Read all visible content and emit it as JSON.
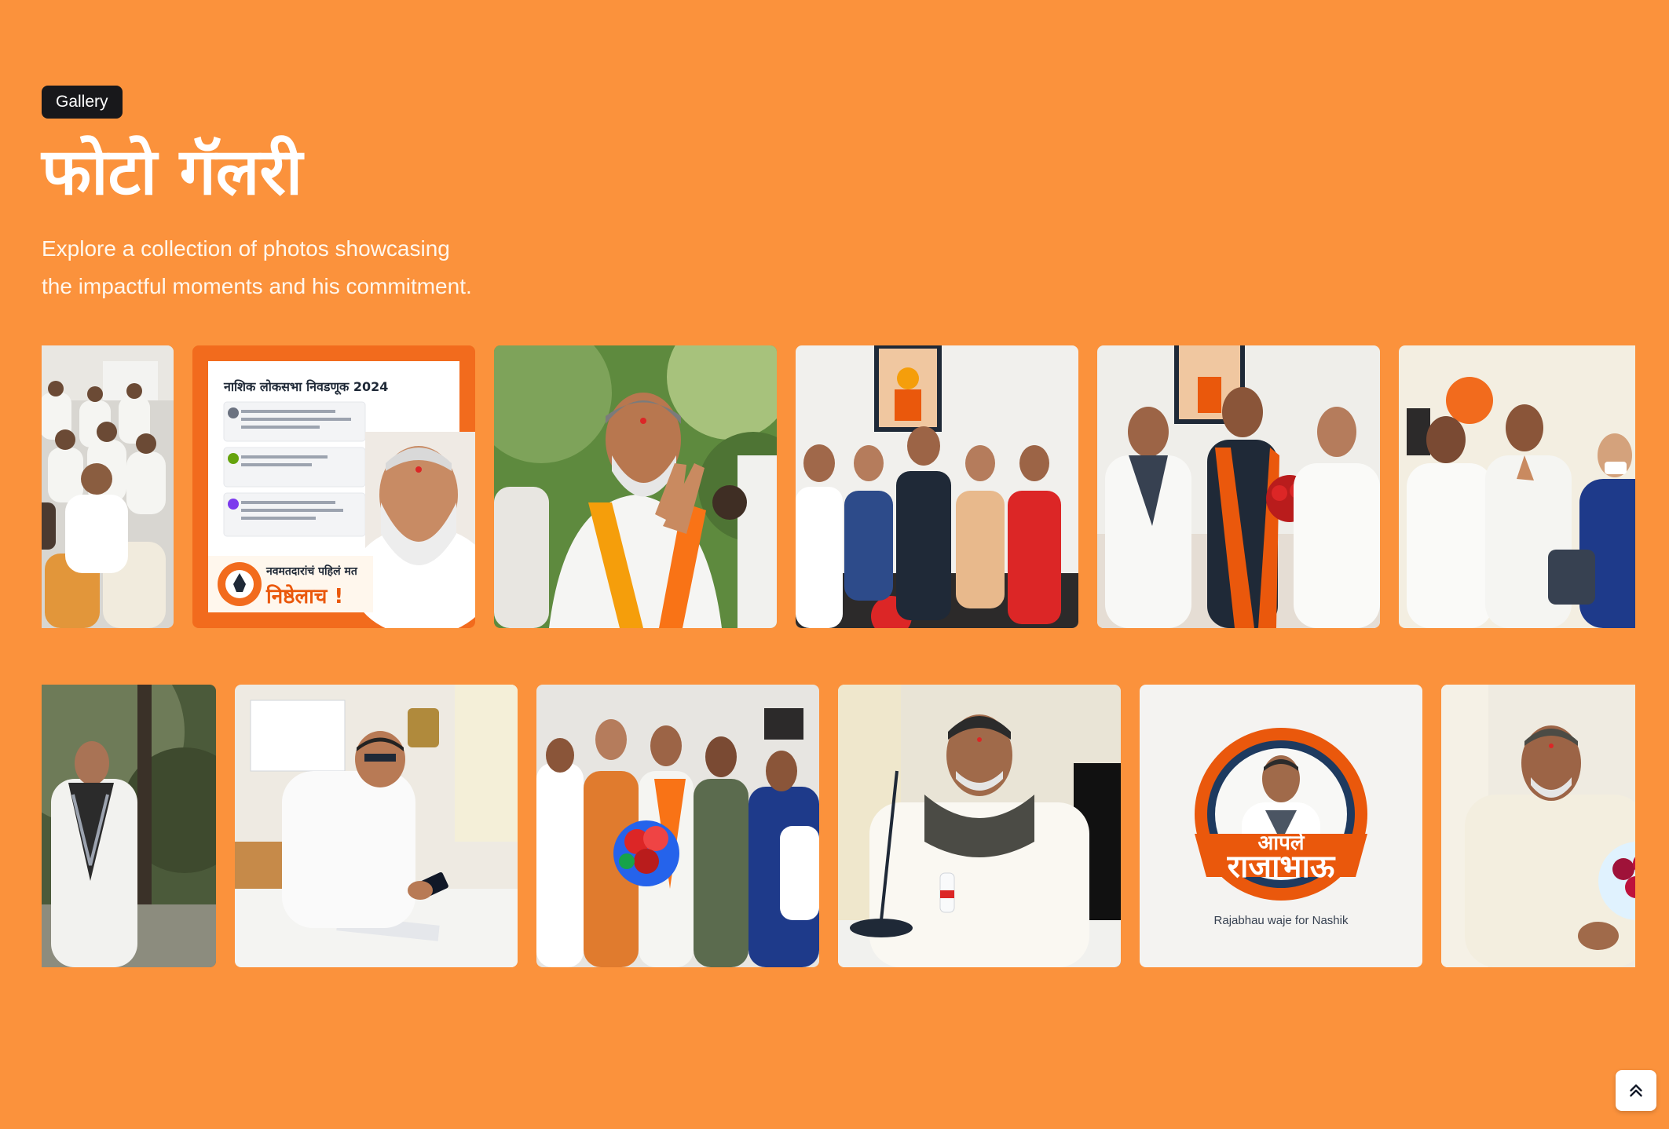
{
  "section": {
    "badge": "Gallery",
    "title": "फोटो गॅलरी",
    "subtitle_line1": "Explore a collection of photos showcasing",
    "subtitle_line2": "the impactful moments and his commitment."
  },
  "colors": {
    "page_background": "#FB923C",
    "badge_background": "#18181B",
    "title_text": "#FFFFFF",
    "accent_orange": "#F97316"
  },
  "gallery": {
    "row1": [
      {
        "alt": "group of supporters seated in an office meeting"
      },
      {
        "alt": "campaign poster",
        "heading": "नाशिक लोकसभा निवडणूक 2024",
        "slogan_top": "नवमतदारांचं पहिलं मत",
        "slogan_bottom": "निष्ठेलाच !"
      },
      {
        "alt": "greeting with folded hands wearing saffron scarf"
      },
      {
        "alt": "group photo in front of a framed portrait"
      },
      {
        "alt": "welcome with a bouquet of red roses"
      },
      {
        "alt": "greeting a party leader with folded hands"
      }
    ],
    "row2": [
      {
        "alt": "walking outdoors among trees wearing a scarf"
      },
      {
        "alt": "working at a desk with a mobile phone"
      },
      {
        "alt": "group with a bouquet of flowers"
      },
      {
        "alt": "speaking at a microphone in a meeting"
      },
      {
        "alt": "campaign logo",
        "logo_line1": "आपले",
        "logo_line2": "राजाभाऊ",
        "caption": "Rajabhau waje for Nashik"
      },
      {
        "alt": "receiving a bouquet of roses"
      }
    ]
  },
  "controls": {
    "scroll_top_icon": "double-chevron-up-icon"
  }
}
